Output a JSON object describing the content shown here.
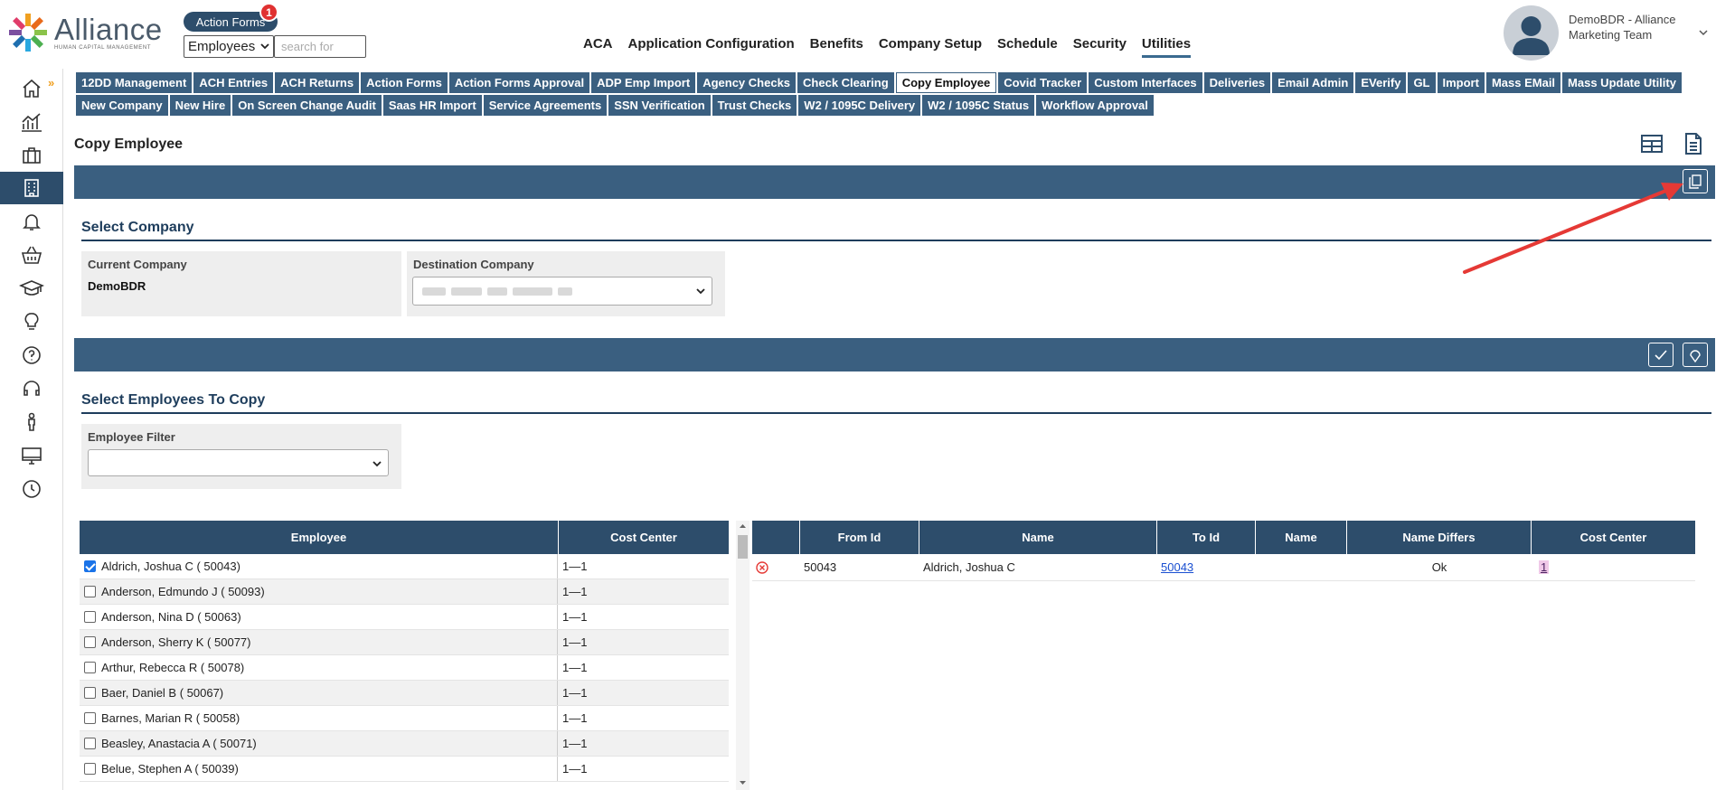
{
  "brand": {
    "name": "Alliance",
    "tagline": "HUMAN CAPITAL MANAGEMENT"
  },
  "header": {
    "action_forms_label": "Action Forms",
    "action_forms_badge": "1",
    "employee_select_value": "Employees",
    "search_placeholder": "search for",
    "nav": [
      "ACA",
      "Application Configuration",
      "Benefits",
      "Company Setup",
      "Schedule",
      "Security",
      "Utilities"
    ],
    "active_nav": "Utilities",
    "user_name": "DemoBDR - Alliance Marketing Team"
  },
  "sidebar": {
    "icons": [
      "home-icon",
      "analytics-icon",
      "briefcase-icon",
      "building-icon",
      "bell-icon",
      "basket-icon",
      "graduation-cap-icon",
      "lightbulb-icon",
      "help-icon",
      "headset-icon",
      "person-icon",
      "monitor-icon",
      "clock-icon"
    ],
    "active": "building-icon"
  },
  "tabs": {
    "row1": [
      "12DD Management",
      "ACH Entries",
      "ACH Returns",
      "Action Forms",
      "Action Forms Approval",
      "ADP Emp Import",
      "Agency Checks",
      "Check Clearing",
      "Copy Employee",
      "Covid Tracker",
      "Custom Interfaces",
      "Deliveries",
      "Email Admin",
      "EVerify",
      "GL",
      "Import",
      "Mass EMail",
      "Mass Update Utility"
    ],
    "row2": [
      "New Company",
      "New Hire",
      "On Screen Change Audit",
      "Saas HR Import",
      "Service Agreements",
      "SSN Verification",
      "Trust Checks",
      "W2 / 1095C Delivery",
      "W2 / 1095C Status",
      "Workflow Approval"
    ],
    "active": "Copy Employee"
  },
  "page": {
    "title": "Copy Employee",
    "select_company": {
      "title": "Select Company",
      "current_label": "Current Company",
      "current_value": "DemoBDR",
      "destination_label": "Destination Company"
    },
    "select_employees": {
      "title": "Select Employees To Copy",
      "filter_label": "Employee Filter",
      "filter_value": ""
    }
  },
  "employees_table": {
    "headers": [
      "Employee",
      "Cost Center"
    ],
    "rows": [
      {
        "name": "Aldrich, Joshua C ( 50043)",
        "cost_center": "1—1",
        "checked": true
      },
      {
        "name": "Anderson, Edmundo J ( 50093)",
        "cost_center": "1—1",
        "checked": false
      },
      {
        "name": "Anderson, Nina D ( 50063)",
        "cost_center": "1—1",
        "checked": false
      },
      {
        "name": "Anderson, Sherry K ( 50077)",
        "cost_center": "1—1",
        "checked": false
      },
      {
        "name": "Arthur, Rebecca R ( 50078)",
        "cost_center": "1—1",
        "checked": false
      },
      {
        "name": "Baer, Daniel B ( 50067)",
        "cost_center": "1—1",
        "checked": false
      },
      {
        "name": "Barnes, Marian R ( 50058)",
        "cost_center": "1—1",
        "checked": false
      },
      {
        "name": "Beasley, Anastacia A ( 50071)",
        "cost_center": "1—1",
        "checked": false
      },
      {
        "name": "Belue, Stephen A ( 50039)",
        "cost_center": "1—1",
        "checked": false
      }
    ]
  },
  "copy_table": {
    "headers": [
      "",
      "From Id",
      "Name",
      "To Id",
      "Name",
      "Name Differs",
      "Cost Center"
    ],
    "rows": [
      {
        "from_id": "50043",
        "name": "Aldrich, Joshua C",
        "to_id": "50043",
        "to_name": "",
        "name_differs": "Ok",
        "cost_center": "1"
      }
    ]
  },
  "colors": {
    "primary": "#2d4d6b",
    "bar": "#3a5f80",
    "accent": "#f0a020",
    "badge": "#e03131",
    "arrow": "#e53935"
  }
}
